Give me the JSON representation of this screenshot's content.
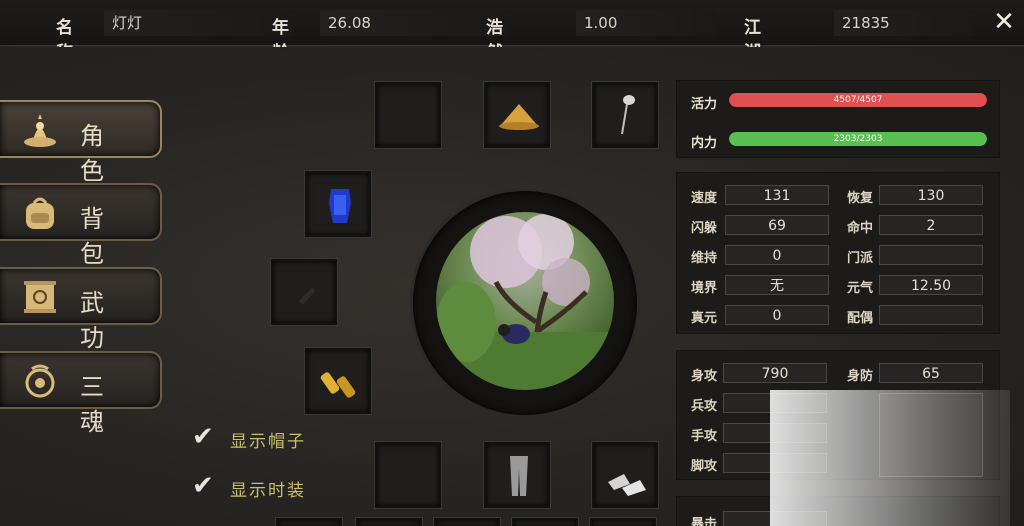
{
  "header": {
    "name_label": "名称",
    "name_value": "灯灯",
    "age_label": "年龄",
    "age_value": "26.08",
    "righteous_label": "浩然正气",
    "righteous_value": "1.00",
    "exp_label": "江湖经验",
    "exp_value": "21835",
    "close_symbol": "✕"
  },
  "tabs": [
    {
      "label": "角色",
      "icon": "character-icon",
      "active": true
    },
    {
      "label": "背包",
      "icon": "backpack-icon",
      "active": false
    },
    {
      "label": "武功",
      "icon": "martial-arts-scroll-icon",
      "active": false
    },
    {
      "label": "三魂",
      "icon": "three-souls-icon",
      "active": false
    }
  ],
  "equipment_slots": [
    {
      "name": "empty-slot-top",
      "icon": ""
    },
    {
      "name": "hat-slot",
      "icon": "straw-hat-icon"
    },
    {
      "name": "accessory-slot",
      "icon": "hairpin-icon"
    },
    {
      "name": "armor-slot",
      "icon": "blue-armor-icon"
    },
    {
      "name": "weapon-slot",
      "icon": "dark-weapon-icon"
    },
    {
      "name": "bracer-slot",
      "icon": "gold-bracer-icon"
    },
    {
      "name": "empty-slot-bottom",
      "icon": ""
    },
    {
      "name": "pants-slot",
      "icon": "pants-icon"
    },
    {
      "name": "boots-slot",
      "icon": "boots-icon"
    }
  ],
  "options": {
    "show_hat": "显示帽子",
    "show_fashion": "显示时装"
  },
  "vitals": {
    "hp_label": "活力",
    "hp_value": "4507/4507",
    "hp_fraction": 1.0,
    "mp_label": "内力",
    "mp_value": "2303/2303",
    "mp_fraction": 1.0
  },
  "stats": {
    "speed_label": "速度",
    "speed": "131",
    "recover_label": "恢复",
    "recover": "130",
    "dodge_label": "闪躲",
    "dodge": "69",
    "hit_label": "命中",
    "hit": "2",
    "maintain_label": "维持",
    "maintain": "0",
    "sect_label": "门派",
    "sect": "",
    "realm_label": "境界",
    "realm": "无",
    "vigor_label": "元气",
    "vigor": "12.50",
    "true_yuan_label": "真元",
    "true_yuan": "0",
    "spouse_label": "配偶",
    "spouse": ""
  },
  "combat": {
    "body_atk_label": "身攻",
    "body_atk": "790",
    "body_def_label": "身防",
    "body_def": "65",
    "weapon_atk_label": "兵攻",
    "hand_atk_label": "手攻",
    "foot_atk_label": "脚攻"
  },
  "bottom": {
    "partial_label": "暴击"
  },
  "colors": {
    "hp_bar": "#e05050",
    "mp_bar": "#58c050",
    "label_gold": "#c9c06a"
  }
}
